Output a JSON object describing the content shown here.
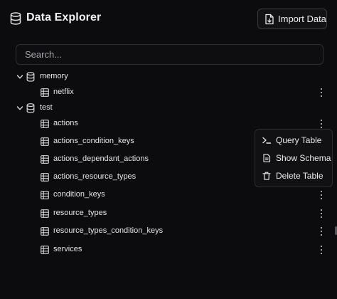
{
  "header": {
    "title": "Data Explorer",
    "import_label": "Import Data"
  },
  "search": {
    "placeholder": "Search..."
  },
  "tree": {
    "databases": [
      {
        "name": "memory",
        "expanded": true,
        "tables": [
          "netflix"
        ]
      },
      {
        "name": "test",
        "expanded": true,
        "tables": [
          "actions",
          "actions_condition_keys",
          "actions_dependant_actions",
          "actions_resource_types",
          "condition_keys",
          "resource_types",
          "resource_types_condition_keys",
          "services"
        ]
      }
    ]
  },
  "context_menu": {
    "items": [
      {
        "label": "Query Table",
        "icon": "terminal-icon"
      },
      {
        "label": "Show Schema",
        "icon": "file-text-icon"
      },
      {
        "label": "Delete Table",
        "icon": "trash-icon"
      }
    ]
  },
  "colors": {
    "background": "#0c0c0e",
    "text": "#e9e9ec",
    "border": "#2e2e34"
  }
}
